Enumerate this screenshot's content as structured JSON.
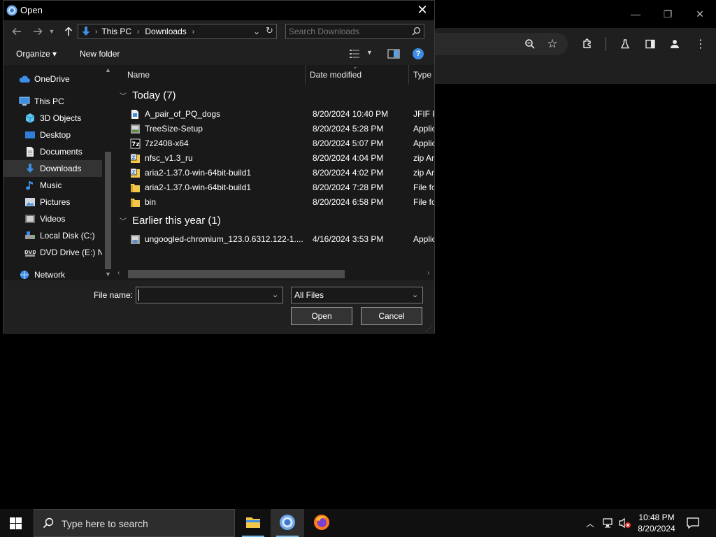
{
  "dialog": {
    "title": "Open",
    "close_glyph": "✕"
  },
  "nav": {
    "breadcrumb": [
      "This PC",
      "Downloads"
    ],
    "search_placeholder": "Search Downloads"
  },
  "commands": {
    "organize": "Organize ▾",
    "new_folder": "New folder"
  },
  "sidebar": {
    "items": [
      {
        "label": "OneDrive",
        "icon": "cloud-icon"
      },
      {
        "label": "This PC",
        "icon": "computer-icon"
      },
      {
        "label": "3D Objects",
        "icon": "cube-icon"
      },
      {
        "label": "Desktop",
        "icon": "desktop-icon"
      },
      {
        "label": "Documents",
        "icon": "document-icon"
      },
      {
        "label": "Downloads",
        "icon": "download-icon"
      },
      {
        "label": "Music",
        "icon": "music-icon"
      },
      {
        "label": "Pictures",
        "icon": "picture-icon"
      },
      {
        "label": "Videos",
        "icon": "video-icon"
      },
      {
        "label": "Local Disk (C:)",
        "icon": "drive-icon"
      },
      {
        "label": "DVD Drive (E:) N",
        "icon": "dvd-icon"
      },
      {
        "label": "Network",
        "icon": "network-icon"
      }
    ]
  },
  "columns": {
    "name": "Name",
    "date": "Date modified",
    "type": "Type"
  },
  "groups": [
    {
      "header": "Today (7)",
      "rows": [
        {
          "name": "A_pair_of_PQ_dogs",
          "date": "8/20/2024 10:40 PM",
          "type": "JFIF Fil",
          "icon": "image-file-icon"
        },
        {
          "name": "TreeSize-Setup",
          "date": "8/20/2024 5:28 PM",
          "type": "Applic",
          "icon": "installer-icon"
        },
        {
          "name": "7z2408-x64",
          "date": "8/20/2024 5:07 PM",
          "type": "Applic",
          "icon": "7zip-icon"
        },
        {
          "name": "nfsc_v1.3_ru",
          "date": "8/20/2024 4:04 PM",
          "type": "zip Arc",
          "icon": "zip-icon"
        },
        {
          "name": "aria2-1.37.0-win-64bit-build1",
          "date": "8/20/2024 4:02 PM",
          "type": "zip Arc",
          "icon": "zip-icon"
        },
        {
          "name": "aria2-1.37.0-win-64bit-build1",
          "date": "8/20/2024 7:28 PM",
          "type": "File fol",
          "icon": "folder-icon"
        },
        {
          "name": "bin",
          "date": "8/20/2024 6:58 PM",
          "type": "File fol",
          "icon": "folder-icon"
        }
      ]
    },
    {
      "header": "Earlier this year (1)",
      "rows": [
        {
          "name": "ungoogled-chromium_123.0.6312.122-1....",
          "date": "4/16/2024 3:53 PM",
          "type": "Applic",
          "icon": "installer-icon"
        }
      ]
    }
  ],
  "bottom": {
    "file_name_label": "File name:",
    "file_name_value": "",
    "file_type": "All Files",
    "open": "Open",
    "cancel": "Cancel"
  },
  "taskbar": {
    "search_placeholder": "Type here to search",
    "time": "10:48 PM",
    "date": "8/20/2024"
  },
  "colors": {
    "accent": "#76b9ed",
    "folder": "#f1c84c",
    "selection": "#333333"
  }
}
